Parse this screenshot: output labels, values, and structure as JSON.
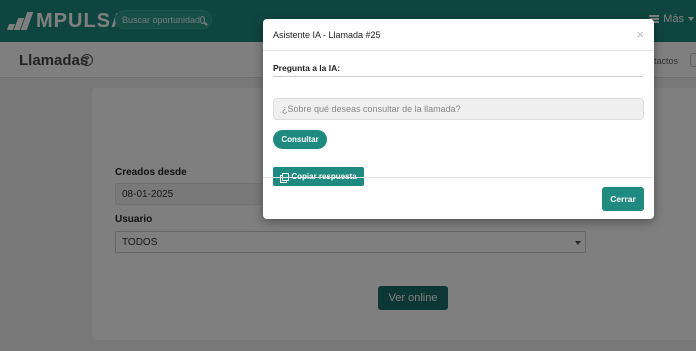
{
  "app": {
    "logo_text": "MPULSA"
  },
  "header": {
    "search_placeholder": "Buscar oportunidad",
    "more_label": "Más"
  },
  "page": {
    "title": "Llamadas",
    "right_tab": "ntactos"
  },
  "form": {
    "created_from_label": "Creados desde",
    "created_from_value": "08-01-2025",
    "user_label": "Usuario",
    "user_value": "TODOS",
    "view_online_button": "Ver online"
  },
  "modal": {
    "title": "Asistente IA - Llamada #25",
    "close_glyph": "×",
    "question_label": "Pregunta a la IA:",
    "question_placeholder": "¿Sobre qué deseas consultar de la llamada?",
    "consult_button": "Consultar",
    "copy_button": "Copiar respuesta",
    "close_button": "Cerrar"
  },
  "colors": {
    "brand": "#1f8a80",
    "brand_dark": "#1a6e69"
  }
}
